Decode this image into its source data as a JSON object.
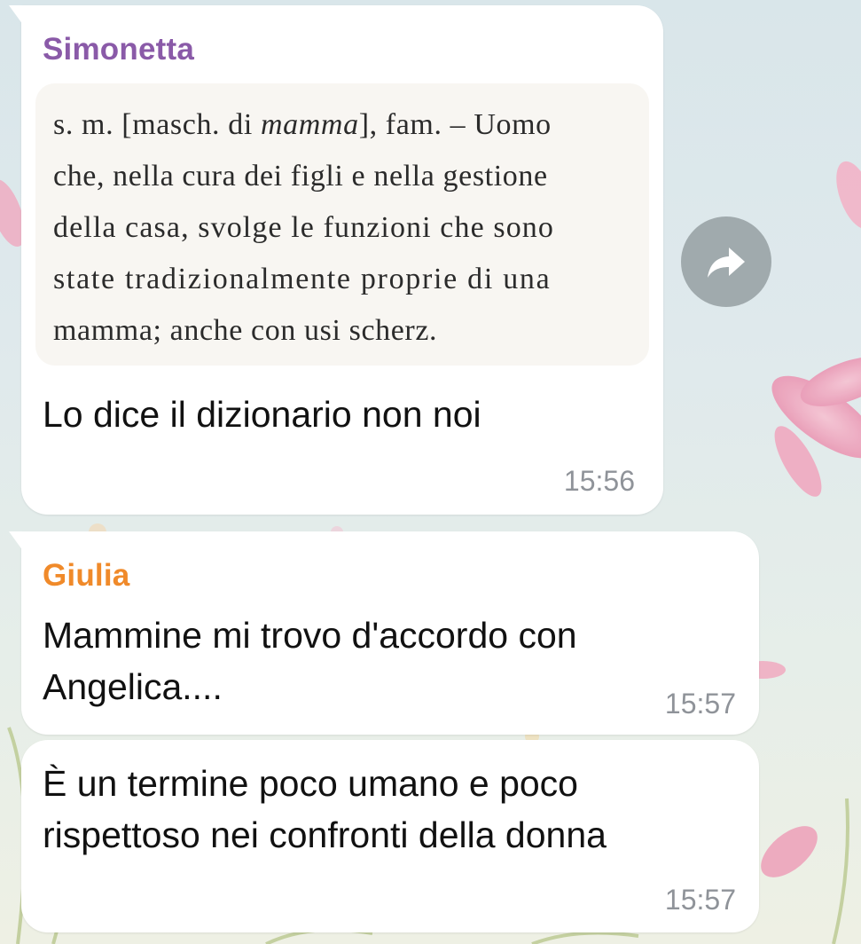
{
  "colors": {
    "simonetta_name": "#8a5aa8",
    "giulia_name": "#f08a2a",
    "timestamp": "#8f9399",
    "share_button": "#a0aaad"
  },
  "messages": [
    {
      "sender": "Simonetta",
      "quote_image": {
        "lines": [
          "s. m. [masch. di ",
          "mamma",
          "], fam. – Uomo",
          "che, nella cura dei figli e nella gestione",
          "della casa, svolge le funzioni che sono",
          "state tradizionalmente proprie di una",
          "mamma; anche con usi scherz."
        ]
      },
      "text": "Lo dice il dizionario non noi",
      "time": "15:56"
    },
    {
      "sender": "Giulia",
      "text_lines": [
        "Mammine mi trovo d'accordo con",
        "Angelica...."
      ],
      "time": "15:57"
    },
    {
      "text_lines": [
        "È un termine poco umano e poco",
        "rispettoso nei confronti della donna"
      ],
      "time": "15:57"
    }
  ],
  "share_icon": "share-arrow-icon"
}
